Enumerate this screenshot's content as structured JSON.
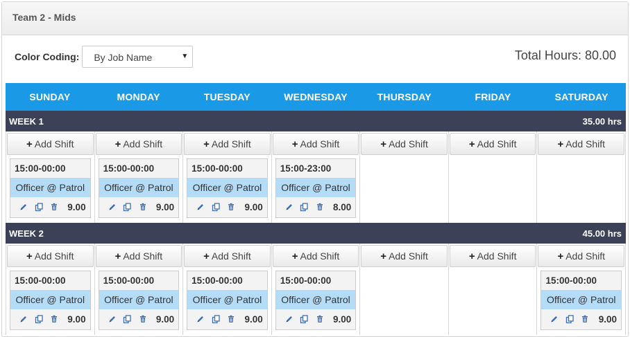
{
  "panel": {
    "title": "Team 2 - Mids"
  },
  "controls": {
    "color_coding_label": "Color Coding:",
    "color_coding_value": "By Job Name"
  },
  "total_hours": "Total Hours: 80.00",
  "days": [
    "SUNDAY",
    "MONDAY",
    "TUESDAY",
    "WEDNESDAY",
    "THURSDAY",
    "FRIDAY",
    "SATURDAY"
  ],
  "add_shift_label": "Add Shift",
  "colors": {
    "header_blue": "#1a9ae6",
    "week_bar": "#3b4258",
    "job_highlight": "#b5dcf7",
    "icon_blue": "#3d6fb6"
  },
  "icons": {
    "edit": "pencil-icon",
    "copy": "copy-icon",
    "delete": "trash-icon",
    "add": "plus-icon"
  },
  "weeks": [
    {
      "label": "WEEK 1",
      "hours": "35.00 hrs",
      "shifts": [
        {
          "time": "15:00-00:00",
          "job": "Officer @ Patrol",
          "hours": "9.00"
        },
        {
          "time": "15:00-00:00",
          "job": "Officer @ Patrol",
          "hours": "9.00"
        },
        {
          "time": "15:00-00:00",
          "job": "Officer @ Patrol",
          "hours": "9.00"
        },
        {
          "time": "15:00-23:00",
          "job": "Officer @ Patrol",
          "hours": "8.00"
        },
        null,
        null,
        null
      ]
    },
    {
      "label": "WEEK 2",
      "hours": "45.00 hrs",
      "shifts": [
        {
          "time": "15:00-00:00",
          "job": "Officer @ Patrol",
          "hours": "9.00"
        },
        {
          "time": "15:00-00:00",
          "job": "Officer @ Patrol",
          "hours": "9.00"
        },
        {
          "time": "15:00-00:00",
          "job": "Officer @ Patrol",
          "hours": "9.00"
        },
        {
          "time": "15:00-00:00",
          "job": "Officer @ Patrol",
          "hours": "9.00"
        },
        null,
        null,
        {
          "time": "15:00-00:00",
          "job": "Officer @ Patrol",
          "hours": "9.00"
        }
      ]
    }
  ]
}
